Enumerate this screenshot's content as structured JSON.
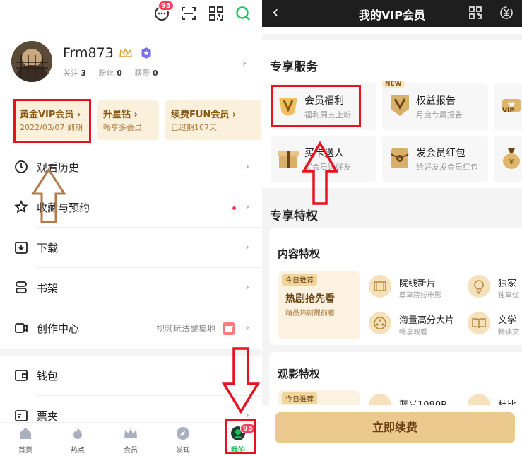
{
  "left": {
    "topbar": {
      "msg_badge": "95"
    },
    "profile": {
      "username": "Frm873",
      "stats": [
        {
          "label": "关注",
          "value": "3"
        },
        {
          "label": "粉丝",
          "value": "0"
        },
        {
          "label": "获赞",
          "value": "0"
        }
      ]
    },
    "vip_cards": [
      {
        "title": "黄金VIP会员 ›",
        "sub": "2022/03/07 到期"
      },
      {
        "title": "升星钻 ›",
        "sub": "畅享多会员"
      },
      {
        "title": "续费FUN会员 ›",
        "sub": "已过期107天"
      }
    ],
    "menu": [
      {
        "label": "观看历史",
        "extra": ""
      },
      {
        "label": "收藏与预约",
        "extra": ""
      },
      {
        "label": "下载",
        "extra": ""
      },
      {
        "label": "书架",
        "extra": ""
      },
      {
        "label": "创作中心",
        "extra": "视频玩法聚集地"
      },
      {
        "label": "钱包",
        "extra": ""
      },
      {
        "label": "票夹",
        "extra": ""
      }
    ],
    "bottom_nav": [
      {
        "label": "首页"
      },
      {
        "label": "热点"
      },
      {
        "label": "会员"
      },
      {
        "label": "发现"
      },
      {
        "label": "我的",
        "badge": "95"
      }
    ],
    "colors": {
      "vip_gold": "#c8901a",
      "active_green": "#17c35f",
      "annot_red": "#e5121f",
      "annot_arrow": "#b07a4a"
    }
  },
  "right": {
    "header": {
      "title": "我的VIP会员",
      "back": "‹"
    },
    "exclusive_services": {
      "title": "专享服务",
      "items": [
        {
          "title": "会员福利",
          "sub": "福利周五上新",
          "badge": ""
        },
        {
          "title": "权益报告",
          "sub": "月度专属报告",
          "badge": "NEW"
        },
        {
          "title": "",
          "sub": "",
          "badge": "",
          "icon_text": "VIP"
        },
        {
          "title": "买卡送人",
          "sub": "买会员送好友",
          "badge": ""
        },
        {
          "title": "发会员红包",
          "sub": "给好友发会员红包",
          "badge": ""
        }
      ]
    },
    "privileges_title": "专享特权",
    "content_privileges": {
      "title": "内容特权",
      "today_tag": "今日推荐",
      "promo_title": "热剧抢先看",
      "promo_sub": "精品热剧提前看",
      "items": [
        {
          "title": "院线新片",
          "sub": "尊享院线电影"
        },
        {
          "title": "独家",
          "sub": "独享优"
        },
        {
          "title": "海量高分大片",
          "sub": "畅享观看"
        },
        {
          "title": "文学",
          "sub": "畅读文"
        }
      ]
    },
    "viewing_privileges": {
      "title": "观影特权",
      "today_tag": "今日推荐",
      "items": [
        {
          "title": "蓝光1080P"
        },
        {
          "title": "杜比"
        }
      ]
    },
    "renew_button": "立即续费",
    "colors": {
      "gold_btn": "#ebc88d",
      "gold_text": "#6b3d12"
    }
  }
}
